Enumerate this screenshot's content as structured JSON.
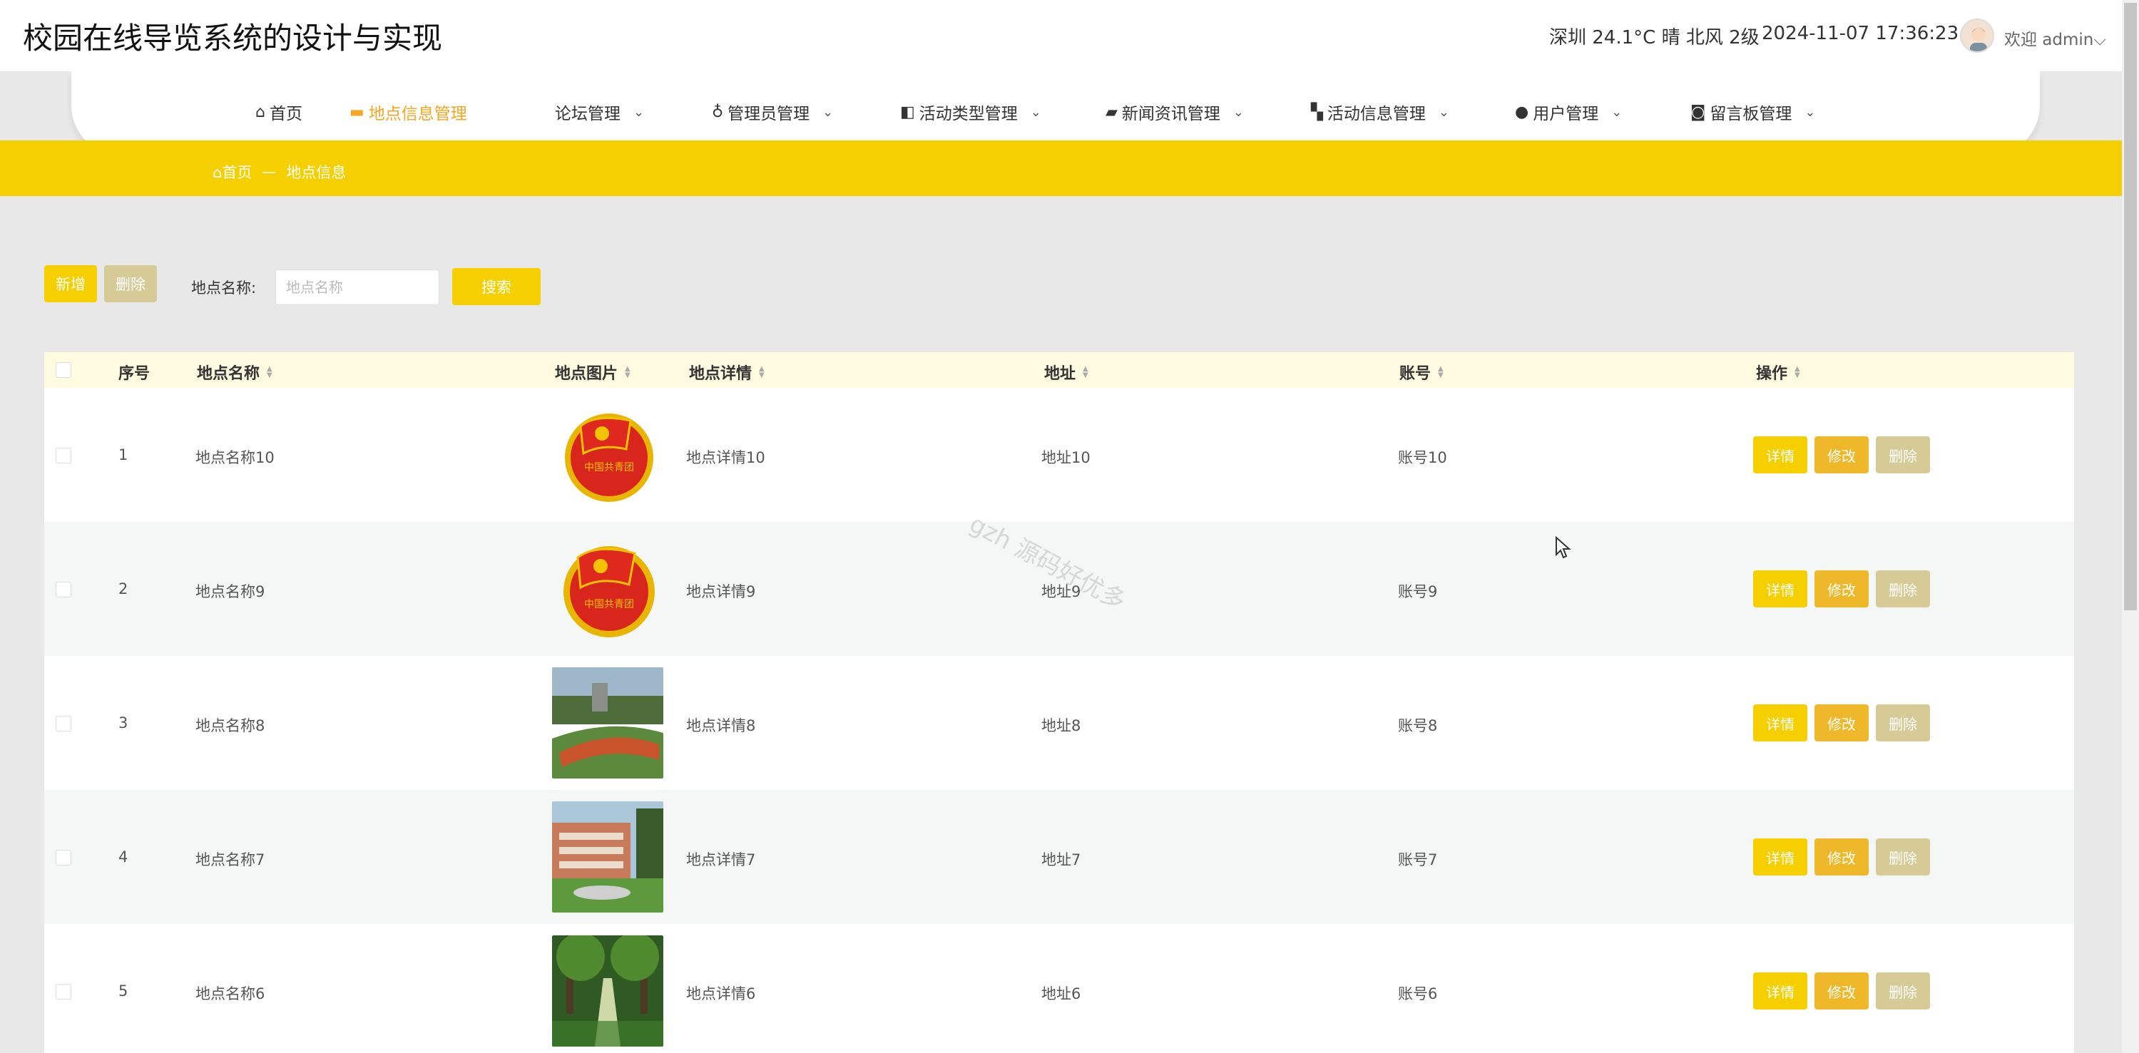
{
  "header": {
    "title": "校园在线导览系统的设计与实现",
    "weather": "深圳 24.1°C 晴 北风 2级",
    "datetime": "2024-11-07 17:36:23",
    "welcome": "欢迎 admin"
  },
  "nav": {
    "items": [
      {
        "label": "首页",
        "icon": "home-icon"
      },
      {
        "label": "地点信息管理",
        "icon": "location-icon"
      },
      {
        "label": "论坛管理",
        "icon": ""
      },
      {
        "label": "管理员管理",
        "icon": "admin-icon"
      },
      {
        "label": "活动类型管理",
        "icon": "type-icon"
      },
      {
        "label": "新闻资讯管理",
        "icon": "news-icon"
      },
      {
        "label": "活动信息管理",
        "icon": "grid-icon"
      },
      {
        "label": "用户管理",
        "icon": "user-icon"
      },
      {
        "label": "留言板管理",
        "icon": "message-icon"
      }
    ]
  },
  "breadcrumb": {
    "home": "首页",
    "separator": "—",
    "current": "地点信息"
  },
  "toolbar": {
    "add_label": "新增",
    "delete_label": "删除",
    "filter_label": "地点名称:",
    "filter_placeholder": "地点名称",
    "search_label": "搜索"
  },
  "table": {
    "columns": [
      "序号",
      "地点名称",
      "地点图片",
      "地点详情",
      "地址",
      "账号",
      "操作"
    ],
    "rows": [
      {
        "index": "1",
        "name": "地点名称10",
        "image": "youth-league-emblem",
        "detail": "地点详情10",
        "address": "地址10",
        "account": "账号10"
      },
      {
        "index": "2",
        "name": "地点名称9",
        "image": "youth-league-emblem",
        "detail": "地点详情9",
        "address": "地址9",
        "account": "账号9"
      },
      {
        "index": "3",
        "name": "地点名称8",
        "image": "campus-track-photo",
        "detail": "地点详情8",
        "address": "地址8",
        "account": "账号8"
      },
      {
        "index": "4",
        "name": "地点名称7",
        "image": "campus-building-photo",
        "detail": "地点详情7",
        "address": "地址7",
        "account": "账号7"
      },
      {
        "index": "5",
        "name": "地点名称6",
        "image": "campus-path-photo",
        "detail": "地点详情6",
        "address": "地址6",
        "account": "账号6"
      }
    ],
    "row_actions": {
      "detail": "详情",
      "edit": "修改",
      "delete": "删除"
    }
  },
  "watermark": "gzh 源码好优多",
  "colors": {
    "accent": "#f5cf00",
    "edit": "#efb82a",
    "muted": "#d6ca96",
    "header_row": "#fffbe0"
  }
}
